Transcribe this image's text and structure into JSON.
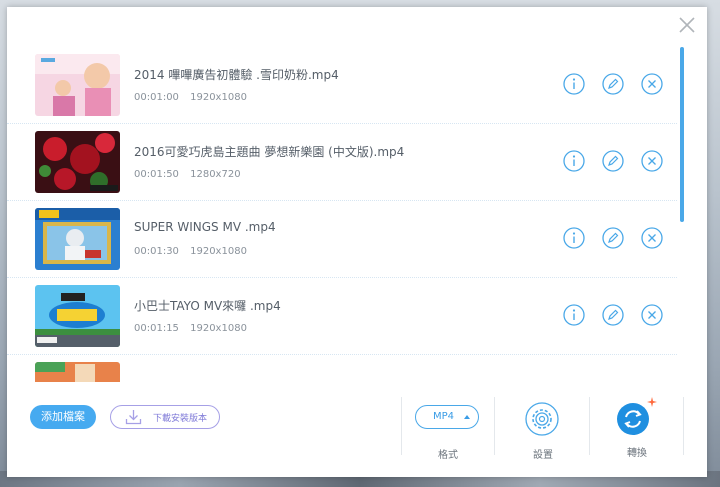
{
  "files": [
    {
      "name": "2014 嗶嗶廣告初體驗 .雪印奶粉.mp4",
      "duration": "00:01:00",
      "resolution": "1920x1080",
      "thumb_icon": "pink-kids-thumbnail"
    },
    {
      "name": "2016可愛巧虎島主題曲 夢想新樂園 (中文版).mp4",
      "duration": "00:01:50",
      "resolution": "1280x720",
      "thumb_icon": "red-flowers-thumbnail"
    },
    {
      "name": "SUPER WINGS MV .mp4",
      "duration": "00:01:30",
      "resolution": "1920x1080",
      "thumb_icon": "super-wings-thumbnail"
    },
    {
      "name": "小巴士TAYO MV來囉 .mp4",
      "duration": "00:01:15",
      "resolution": "1920x1080",
      "thumb_icon": "tayo-thumbnail"
    }
  ],
  "actions": {
    "add_label": "添加檔案",
    "download_label": "下載安裝版本"
  },
  "format": {
    "value": "MP4",
    "label": "格式"
  },
  "settings_label": "設置",
  "convert_label": "轉換",
  "colors": {
    "accent": "#46aaf0",
    "icon_blue": "#4aa8e8",
    "download_border": "#a6a0e6",
    "convert_badge": "#ff6a3d"
  }
}
